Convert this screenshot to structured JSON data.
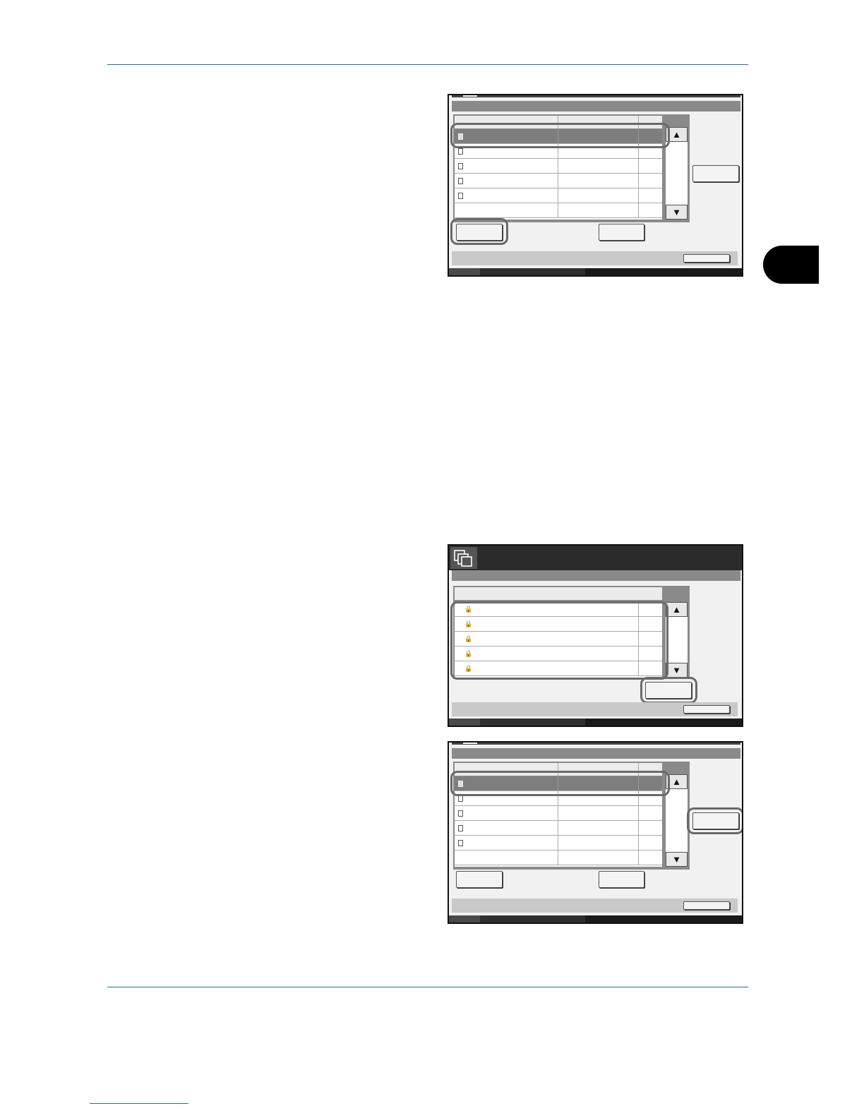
{
  "page": {
    "accent_color": "#1d6fa8",
    "chapter_tab_color": "#000000"
  },
  "panels": [
    {
      "id": "document-list",
      "rows": [
        {
          "selected": true
        },
        {
          "selected": false
        },
        {
          "selected": false
        },
        {
          "selected": false
        },
        {
          "selected": false
        },
        {
          "selected": false
        }
      ],
      "highlighted": [
        "first-row",
        "left-bottom-button"
      ],
      "icons": [
        "document-icon",
        "scroll-up-icon",
        "scroll-down-icon"
      ]
    },
    {
      "id": "box-list",
      "rows": [
        {
          "locked": true
        },
        {
          "locked": true
        },
        {
          "locked": true
        },
        {
          "locked": true
        },
        {
          "locked": true
        }
      ],
      "highlighted": [
        "box-rows",
        "open-button"
      ],
      "icons": [
        "document-box-icon",
        "lock-icon",
        "scroll-up-icon",
        "scroll-down-icon"
      ]
    },
    {
      "id": "document-list-selected",
      "rows": [
        {
          "selected": true
        },
        {
          "selected": false
        },
        {
          "selected": false
        },
        {
          "selected": false
        },
        {
          "selected": false
        },
        {
          "selected": false
        }
      ],
      "highlighted": [
        "first-row",
        "right-side-button"
      ],
      "icons": [
        "document-icon",
        "scroll-up-icon",
        "scroll-down-icon"
      ]
    }
  ],
  "glyphs": {
    "scroll_up": "▲",
    "scroll_down": "▼",
    "lock": "🔒"
  }
}
